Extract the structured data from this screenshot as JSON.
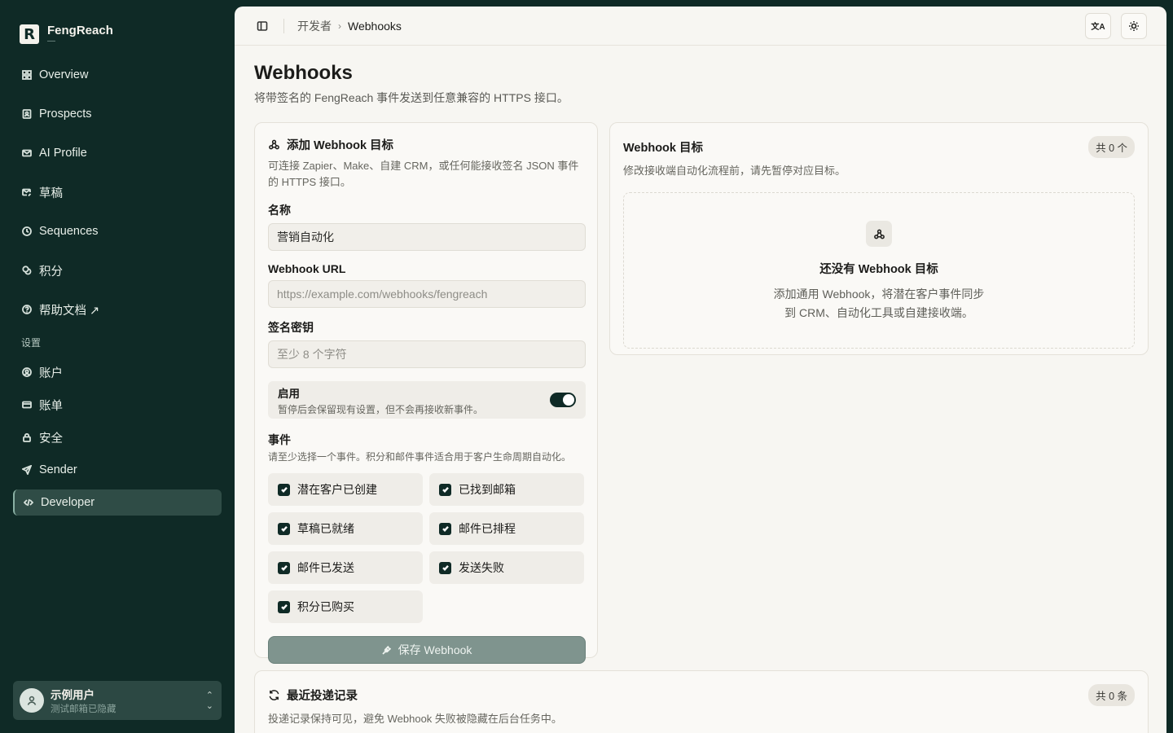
{
  "brand": {
    "name": "FengReach",
    "sub": "—"
  },
  "sidebar": {
    "items": [
      {
        "label": "Overview",
        "icon": "grid-icon"
      },
      {
        "label": "Prospects",
        "icon": "contact-icon"
      },
      {
        "label": "AI Profile",
        "icon": "mail-icon"
      },
      {
        "label": "草稿",
        "icon": "mail-edit-icon"
      },
      {
        "label": "Sequences",
        "icon": "clock-icon"
      },
      {
        "label": "积分",
        "icon": "coins-icon"
      },
      {
        "label": "帮助文档 ↗",
        "icon": "help-icon"
      }
    ],
    "settings_label": "设置",
    "settings_items": [
      {
        "label": "账户",
        "icon": "user-circle-icon"
      },
      {
        "label": "账单",
        "icon": "card-icon"
      },
      {
        "label": "安全",
        "icon": "lock-icon"
      },
      {
        "label": "Sender",
        "icon": "send-icon"
      },
      {
        "label": "Developer",
        "icon": "code-icon",
        "active": true
      }
    ],
    "user": {
      "name": "示例用户",
      "email": "测试邮箱已隐藏"
    }
  },
  "topbar": {
    "breadcrumb_parent": "开发者",
    "breadcrumb_current": "Webhooks",
    "lang_button": "文A",
    "theme_icon": "sun-icon"
  },
  "page": {
    "title": "Webhooks",
    "description": "将带签名的 FengReach 事件发送到任意兼容的 HTTPS 接口。"
  },
  "add_card": {
    "title": "添加 Webhook 目标",
    "description": "可连接 Zapier、Make、自建 CRM，或任何能接收签名 JSON 事件的 HTTPS 接口。",
    "name_label": "名称",
    "name_value": "营销自动化",
    "url_label": "Webhook URL",
    "url_placeholder": "https://example.com/webhooks/fengreach",
    "secret_label": "签名密钥",
    "secret_placeholder": "至少 8 个字符",
    "enable_title": "启用",
    "enable_desc": "暂停后会保留现有设置，但不会再接收新事件。",
    "enabled": true,
    "events_title": "事件",
    "events_desc": "请至少选择一个事件。积分和邮件事件适合用于客户生命周期自动化。",
    "events": [
      {
        "label": "潜在客户已创建",
        "checked": true
      },
      {
        "label": "已找到邮箱",
        "checked": true
      },
      {
        "label": "草稿已就绪",
        "checked": true
      },
      {
        "label": "邮件已排程",
        "checked": true
      },
      {
        "label": "邮件已发送",
        "checked": true
      },
      {
        "label": "发送失败",
        "checked": true
      },
      {
        "label": "积分已购买",
        "checked": true
      }
    ],
    "save_label": "保存 Webhook"
  },
  "targets_card": {
    "title": "Webhook 目标",
    "description": "修改接收端自动化流程前，请先暂停对应目标。",
    "count_badge": "共 0 个",
    "empty_title": "还没有 Webhook 目标",
    "empty_desc": "添加通用 Webhook，将潜在客户事件同步到 CRM、自动化工具或自建接收端。"
  },
  "log_card": {
    "title": "最近投递记录",
    "description": "投递记录保持可见，避免 Webhook 失败被隐藏在后台任务中。",
    "count_badge": "共 0 条"
  }
}
